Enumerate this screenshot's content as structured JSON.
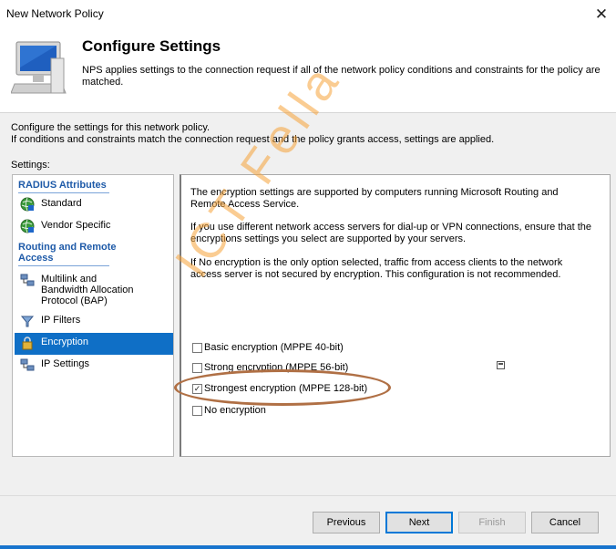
{
  "window": {
    "title": "New Network Policy"
  },
  "header": {
    "title": "Configure Settings",
    "description_line1": "NPS applies settings to the connection request if all of the network policy conditions and constraints for the policy are",
    "description_line2": "matched."
  },
  "intro": {
    "line1": "Configure the settings for this network policy.",
    "line2": "If conditions and constraints match the connection request and the policy grants access, settings are applied."
  },
  "settings_label": "Settings:",
  "tree": {
    "radius_header": "RADIUS Attributes",
    "radius_items": [
      {
        "label": "Standard",
        "icon": "globe-icon"
      },
      {
        "label": "Vendor Specific",
        "icon": "globe-icon"
      }
    ],
    "routing_header_line1": "Routing and Remote",
    "routing_header_line2": "Access",
    "routing_items": [
      {
        "label_line1": "Multilink and",
        "label_line2": "Bandwidth Allocation",
        "label_line3": "Protocol (BAP)",
        "icon": "network-computers-icon"
      },
      {
        "label": "IP Filters",
        "icon": "filter-funnel-icon"
      },
      {
        "label": "Encryption",
        "icon": "lock-icon",
        "selected": true
      },
      {
        "label": "IP Settings",
        "icon": "network-computers-icon"
      }
    ]
  },
  "pane": {
    "para1_line1": "The encryption settings are supported by computers running Microsoft Routing and",
    "para1_line2": "Remote Access Service.",
    "para2_line1": "If you use different network access servers for dial-up or VPN connections, ensure that the",
    "para2_line2": "encryptions settings you select are supported by your servers.",
    "para3_line1": "If No encryption is the only option selected, traffic from access clients to the network",
    "para3_line2": "access server is not secured by encryption. This configuration is not recommended.",
    "options": [
      {
        "label": "Basic encryption (MPPE 40-bit)",
        "checked": false
      },
      {
        "label": "Strong encryption (MPPE 56-bit)",
        "checked": false
      },
      {
        "label": "Strongest encryption (MPPE 128-bit)",
        "checked": true
      },
      {
        "label": "No encryption",
        "checked": false
      }
    ]
  },
  "watermark": "ICT Fella",
  "buttons": {
    "previous": "Previous",
    "next": "Next",
    "finish": "Finish",
    "cancel": "Cancel"
  },
  "colors": {
    "selection": "#0f6fc6",
    "link_header": "#1e5aa8",
    "watermark": "#f6a33a",
    "annotation_ellipse": "#b07045"
  }
}
